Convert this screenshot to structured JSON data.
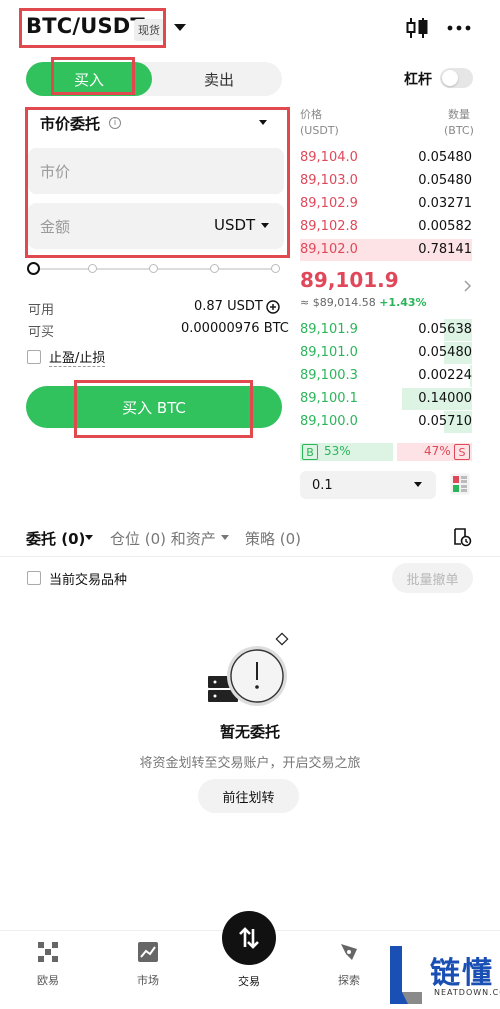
{
  "header": {
    "pair": "BTC/USDT",
    "market_badge": "现货"
  },
  "trade_side": {
    "buy": "买入",
    "sell": "卖出"
  },
  "leverage": {
    "label": "杠杆",
    "enabled": false
  },
  "order_form": {
    "order_type": "市价委托",
    "price_placeholder": "市价",
    "amount_placeholder": "金额",
    "amount_unit": "USDT",
    "slider_percent": 0,
    "available_label": "可用",
    "available_value": "0.87 USDT",
    "can_buy_label": "可买",
    "can_buy_value": "0.00000976 BTC",
    "tp_sl_label": "止盈/止损",
    "submit_label": "买入 BTC"
  },
  "order_book": {
    "price_header": "价格",
    "price_unit": "(USDT)",
    "qty_header": "数量",
    "qty_unit": "(BTC)",
    "asks": [
      {
        "price": "89,104.0",
        "qty": "0.05480",
        "depth": 0
      },
      {
        "price": "89,103.0",
        "qty": "0.05480",
        "depth": 0
      },
      {
        "price": "89,102.9",
        "qty": "0.03271",
        "depth": 0
      },
      {
        "price": "89,102.8",
        "qty": "0.00582",
        "depth": 0
      },
      {
        "price": "89,102.0",
        "qty": "0.78141",
        "depth": 1.0
      }
    ],
    "last_price": "89,101.9",
    "index_price": "≈ $89,014.58",
    "change": "+1.43%",
    "bids": [
      {
        "price": "89,101.9",
        "qty": "0.05638",
        "depth": 0.4
      },
      {
        "price": "89,101.0",
        "qty": "0.05480",
        "depth": 0.4
      },
      {
        "price": "89,100.3",
        "qty": "0.00224",
        "depth": 0.03
      },
      {
        "price": "89,100.1",
        "qty": "0.14000",
        "depth": 1.0
      },
      {
        "price": "89,100.0",
        "qty": "0.05710",
        "depth": 0.4
      }
    ],
    "buy_ratio": "53%",
    "sell_ratio": "47%",
    "buy_badge": "B",
    "sell_badge": "S",
    "step": "0.1"
  },
  "tabs": [
    {
      "label": "委托 (0)"
    },
    {
      "label": "仓位 (0) 和资产"
    },
    {
      "label": "策略 (0)"
    }
  ],
  "filter": {
    "current_pair_label": "当前交易品种",
    "batch_cancel": "批量撤单"
  },
  "empty_state": {
    "title": "暂无委托",
    "subtitle": "将资金划转至交易账户，开启交易之旅",
    "button": "前往划转"
  },
  "bottom_nav": [
    {
      "label": "欧易",
      "icon": "okx-logo-icon"
    },
    {
      "label": "市场",
      "icon": "chart-icon"
    },
    {
      "label": "交易",
      "icon": "trade-swap-icon"
    },
    {
      "label": "探索",
      "icon": "explore-icon"
    }
  ],
  "watermark": {
    "text": "链懂",
    "sub": "NEATDOWN.COM"
  },
  "colors": {
    "buy_green": "#31c25e",
    "sell_red": "#e0485a",
    "highlight_box": "#e04a4f"
  }
}
